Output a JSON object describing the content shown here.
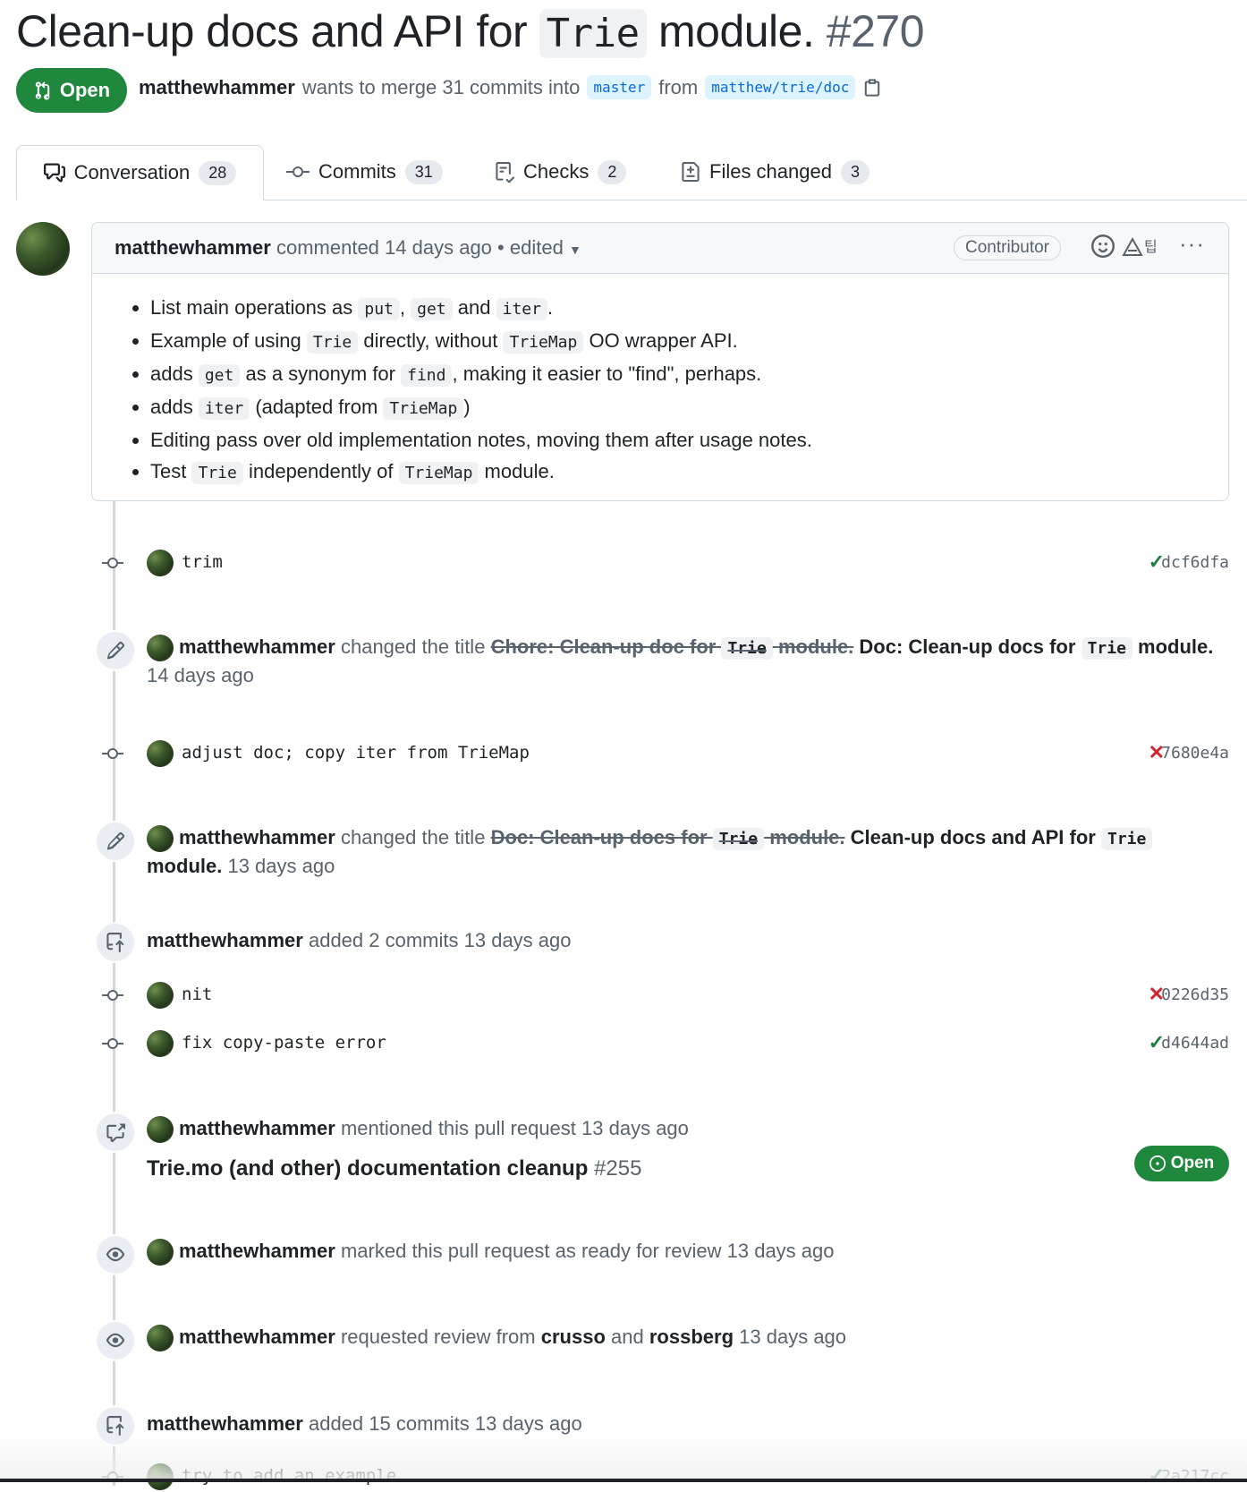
{
  "pr": {
    "title_pre": "Clean-up docs and API for",
    "title_code": "Trie",
    "title_post": "module.",
    "number": "#270",
    "state": "Open",
    "author": "matthewhammer",
    "merge_text": "wants to merge 31 commits into",
    "base_branch": "master",
    "from_text": "from",
    "head_branch": "matthew/trie/doc"
  },
  "tabs": [
    {
      "label": "Conversation",
      "count": "28"
    },
    {
      "label": "Commits",
      "count": "31"
    },
    {
      "label": "Checks",
      "count": "2"
    },
    {
      "label": "Files changed",
      "count": "3"
    }
  ],
  "comment": {
    "author": "matthewhammer",
    "action": "commented",
    "time": "14 days ago",
    "edited": "• edited",
    "role": "Contributor",
    "items": {
      "i1": {
        "a": "List main operations as",
        "c1": "put",
        "b": ",",
        "c2": "get",
        "d": "and",
        "c3": "iter",
        "e": "."
      },
      "i2": {
        "a": "Example of using",
        "c1": "Trie",
        "b": "directly, without",
        "c2": "TrieMap",
        "d": "OO wrapper API."
      },
      "i3": {
        "a": "adds",
        "c1": "get",
        "b": "as a synonym for",
        "c2": "find",
        "d": ", making it easier to \"find\", perhaps."
      },
      "i4": {
        "a": "adds",
        "c1": "iter",
        "b": "(adapted from",
        "c2": "TrieMap",
        "d": ")"
      },
      "i5": {
        "a": "Editing pass over old implementation notes, moving them after usage notes."
      },
      "i6": {
        "a": "Test",
        "c1": "Trie",
        "b": "independently of",
        "c2": "TrieMap",
        "d": "module."
      }
    }
  },
  "timeline": {
    "c1": {
      "msg": "trim",
      "status": "✓",
      "sha": "dcf6dfa"
    },
    "t1": {
      "author": "matthewhammer",
      "action": "changed the title",
      "old_a": "Chore: Clean-up doc for",
      "old_code": "Trie",
      "old_b": "module.",
      "new_a": "Doc: Clean-up docs for",
      "new_code": "Trie",
      "new_b": "module.",
      "time": "14 days ago"
    },
    "c2": {
      "msg": "adjust doc; copy iter from TrieMap",
      "status": "✕",
      "sha": "7680e4a"
    },
    "t2": {
      "author": "matthewhammer",
      "action": "changed the title",
      "old_a": "Doc: Clean-up docs for",
      "old_code": "Trie",
      "old_b": "module.",
      "new_a": "Clean-up docs and API for",
      "new_code": "Trie",
      "new_b": "module.",
      "time": "13 days ago"
    },
    "a1": {
      "author": "matthewhammer",
      "text": "added 2 commits",
      "time": "13 days ago"
    },
    "c3": {
      "msg": "nit",
      "status": "✕",
      "sha": "0226d35"
    },
    "c4": {
      "msg": "fix copy-paste error",
      "status": "✓",
      "sha": "d4644ad"
    },
    "m1": {
      "author": "matthewhammer",
      "text": "mentioned this pull request",
      "time": "13 days ago",
      "ref_title": "Trie.mo (and other) documentation cleanup",
      "ref_num": "#255",
      "ref_state": "Open"
    },
    "r1": {
      "author": "matthewhammer",
      "text": "marked this pull request as ready for review",
      "time": "13 days ago"
    },
    "r2": {
      "author": "matthewhammer",
      "text": "requested review from",
      "rev1": "crusso",
      "and": "and",
      "rev2": "rossberg",
      "time": "13 days ago"
    },
    "a2": {
      "author": "matthewhammer",
      "text": "added 15 commits",
      "time": "13 days ago"
    },
    "c5": {
      "msg": "try to add an example",
      "status": "✓",
      "sha": "2a217cc"
    }
  }
}
